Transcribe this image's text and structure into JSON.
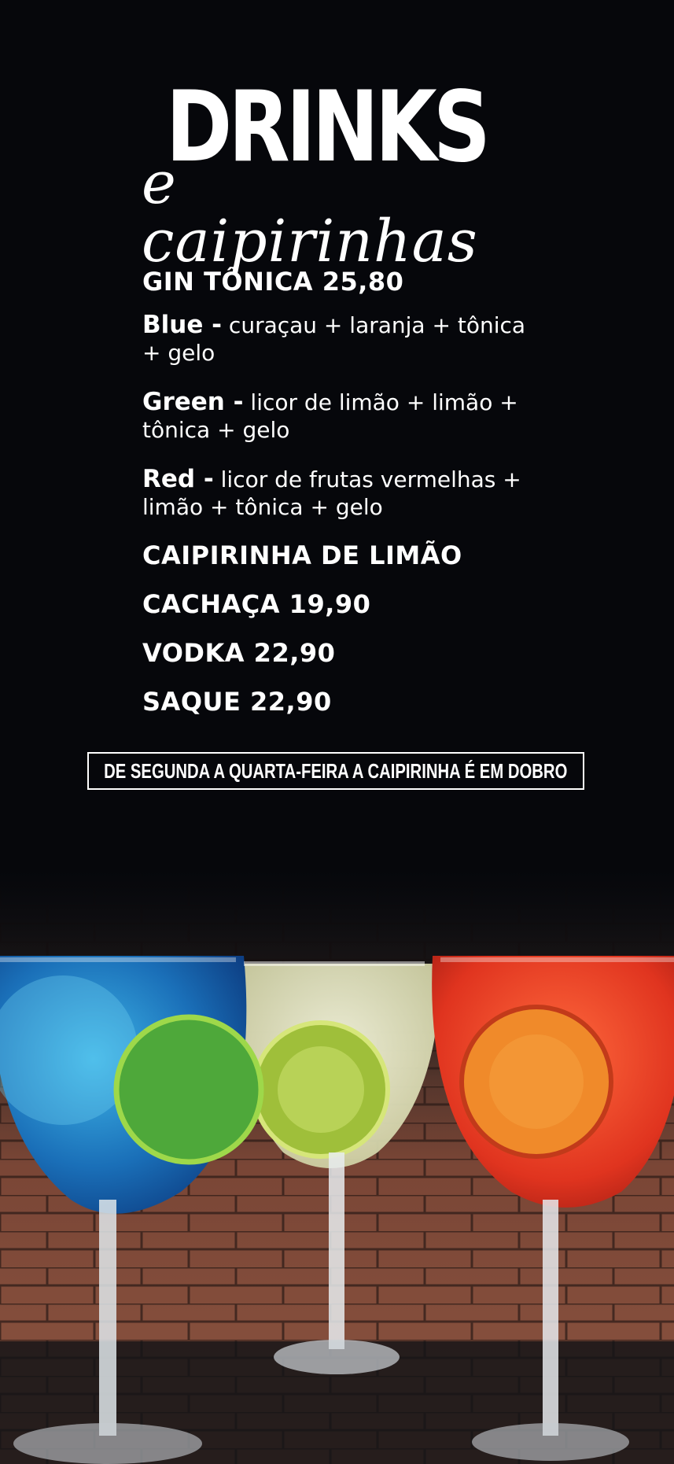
{
  "header": {
    "title": "DRINKS",
    "subtitle": "e caipirinhas"
  },
  "gin_tonica": {
    "heading": "GIN TÔNICA 25,80",
    "variants": [
      {
        "name": "Blue -",
        "desc": "curaçau + laranja + tônica",
        "desc2": "+ gelo"
      },
      {
        "name": "Green -",
        "desc": "licor de limão + limão +",
        "desc2": "tônica + gelo"
      },
      {
        "name": "Red -",
        "desc": "licor de frutas vermelhas +",
        "desc2": "limão + tônica + gelo"
      }
    ]
  },
  "caipirinha": {
    "heading": "CAIPIRINHA DE LIMÃO",
    "options": [
      "CACHAÇA 19,90",
      "VODKA 22,90",
      "SAQUE 22,90"
    ]
  },
  "promo": {
    "text": "DE SEGUNDA A QUARTA-FEIRA A CAIPIRINHA É EM DOBRO"
  },
  "colors": {
    "background": "#06070b",
    "text": "#ffffff",
    "brick": "#8a4e3b",
    "drink_blue": "#1f7fc4",
    "drink_clear": "#e6e8c8",
    "drink_red": "#e2452a"
  },
  "photo": {
    "icon": "cocktail-glasses-image"
  }
}
